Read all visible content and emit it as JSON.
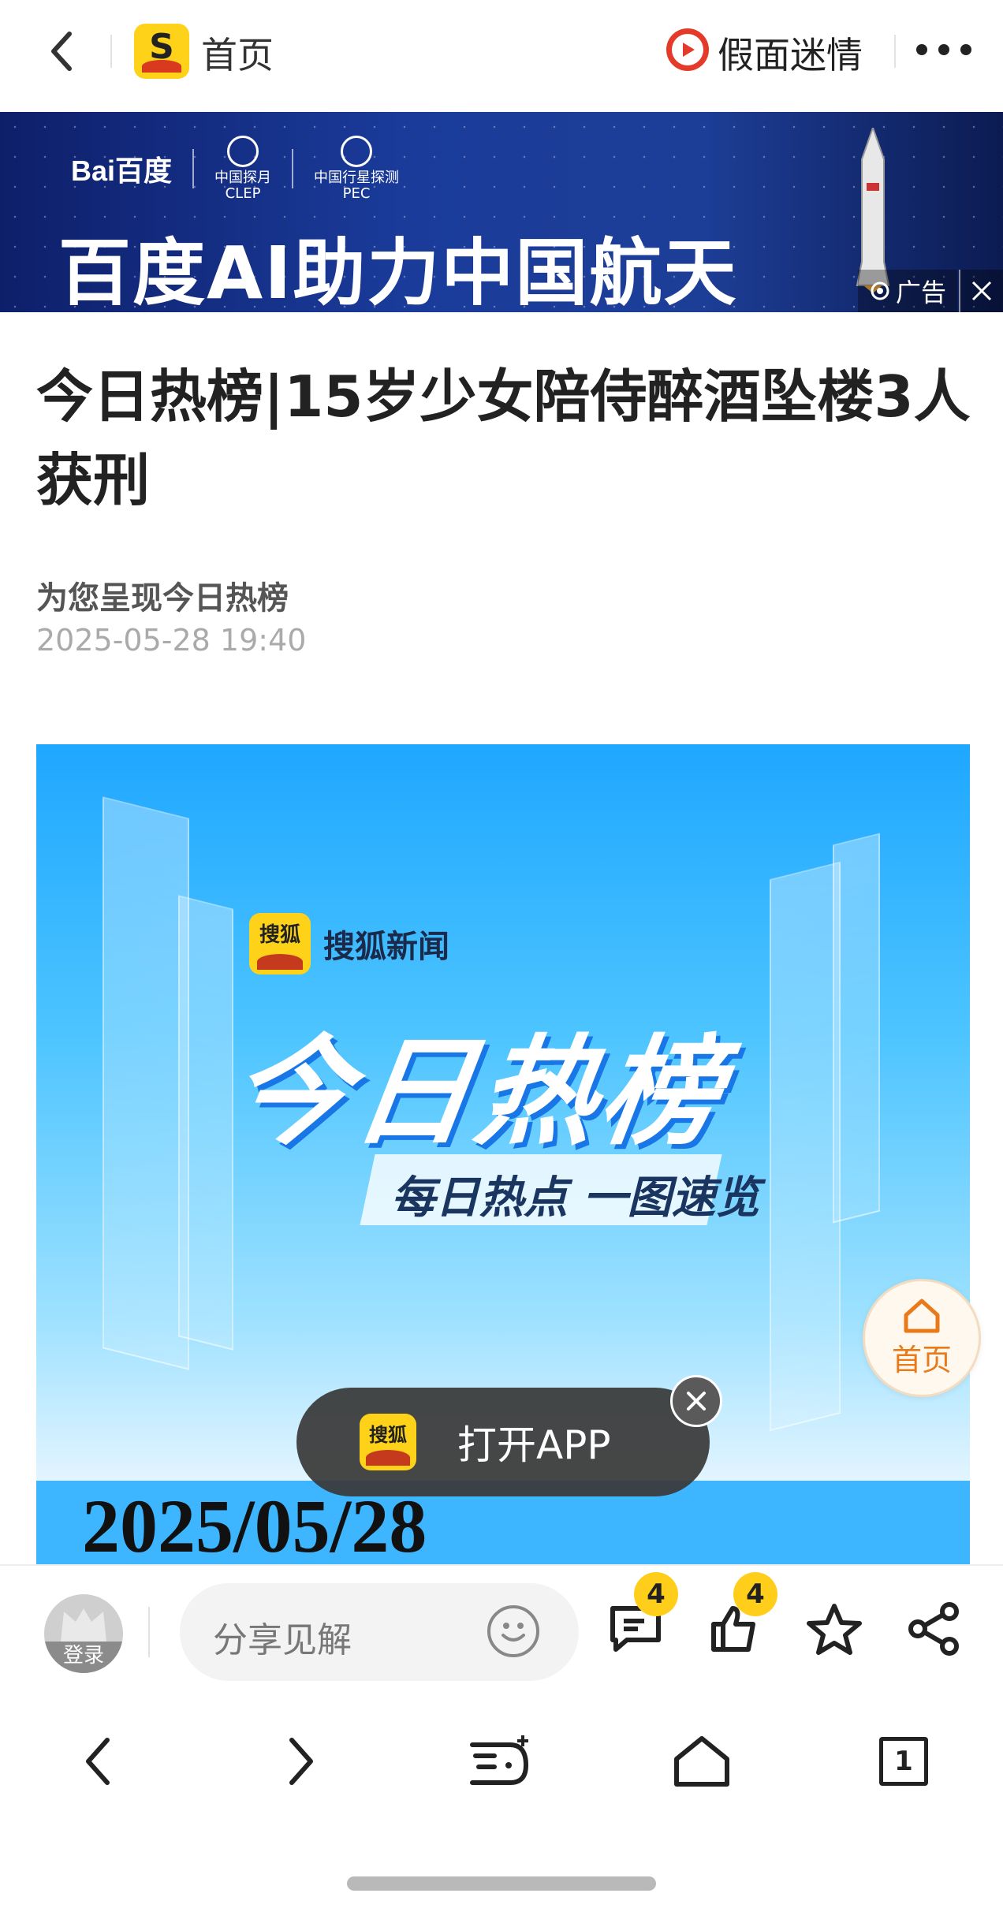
{
  "topbar": {
    "home_label": "首页",
    "author_name": "假面迷情"
  },
  "ad": {
    "logo_baidu": "Bai百度",
    "logo_clep": "中国探月",
    "logo_clep_en": "CLEP",
    "logo_pec": "中国行星探测",
    "logo_pec_en": "PEC",
    "headline": "百度AI助力中国航天",
    "tag": "广告"
  },
  "article": {
    "title": "今日热榜|15岁少女陪侍醉酒坠楼3人获刑",
    "source": "为您呈现今日热榜",
    "date": "2025-05-28 19:40"
  },
  "hero": {
    "brand_icon": "搜狐",
    "brand_name": "搜狐新闻",
    "big_title": "今日热榜",
    "subtitle": "每日热点 一图速览",
    "date": "2025/05/28"
  },
  "float_home": {
    "label": "首页"
  },
  "open_app": {
    "icon_text": "搜狐",
    "label": "打开APP"
  },
  "comment_bar": {
    "avatar_label": "登录",
    "placeholder": "分享见解",
    "comment_count": "4",
    "like_count": "4"
  },
  "browser_bar": {
    "tab_count": "1"
  },
  "colors": {
    "brand_yellow": "#ffd21a",
    "accent_orange": "#e87a1a",
    "ad_blue": "#1a3b9a"
  }
}
